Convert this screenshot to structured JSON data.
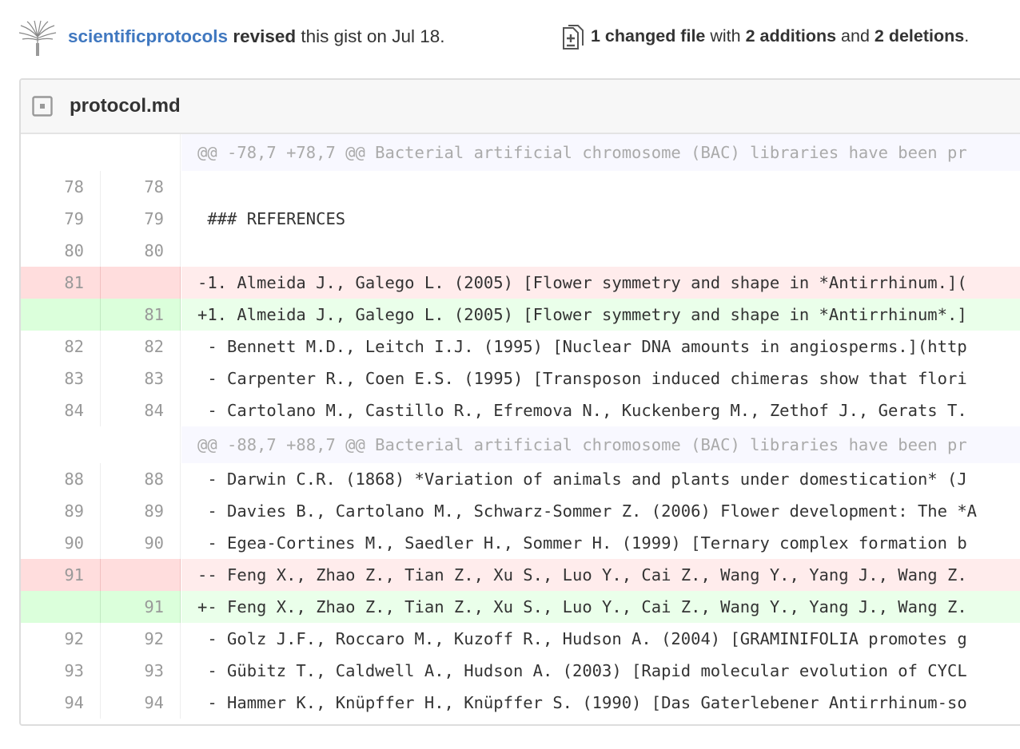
{
  "header": {
    "username": "scientificprotocols",
    "action": "revised",
    "rest": "this gist on Jul 18.",
    "summary": {
      "changed": "1 changed file",
      "with": "with",
      "additions": "2 additions",
      "and": "and",
      "deletions": "2 deletions",
      "period": "."
    }
  },
  "file": {
    "name": "protocol.md"
  },
  "diff": [
    {
      "type": "hunk",
      "old": "",
      "new": "",
      "text": "@@ -78,7 +78,7 @@ Bacterial artificial chromosome (BAC) libraries have been pr"
    },
    {
      "type": "ctx",
      "old": "78",
      "new": "78",
      "text": " "
    },
    {
      "type": "ctx",
      "old": "79",
      "new": "79",
      "text": " ### REFERENCES"
    },
    {
      "type": "ctx",
      "old": "80",
      "new": "80",
      "text": " "
    },
    {
      "type": "del",
      "old": "81",
      "new": "",
      "text": "-1. Almeida J., Galego L. (2005) [Flower symmetry and shape in *Antirrhinum.]("
    },
    {
      "type": "add",
      "old": "",
      "new": "81",
      "text": "+1. Almeida J., Galego L. (2005) [Flower symmetry and shape in *Antirrhinum*.]"
    },
    {
      "type": "ctx",
      "old": "82",
      "new": "82",
      "text": " - Bennett M.D., Leitch I.J. (1995) [Nuclear DNA amounts in angiosperms.](http"
    },
    {
      "type": "ctx",
      "old": "83",
      "new": "83",
      "text": " - Carpenter R., Coen E.S. (1995) [Transposon induced chimeras show that flori"
    },
    {
      "type": "ctx",
      "old": "84",
      "new": "84",
      "text": " - Cartolano M., Castillo R., Efremova N., Kuckenberg M., Zethof J., Gerats T."
    },
    {
      "type": "hunk",
      "old": "",
      "new": "",
      "text": "@@ -88,7 +88,7 @@ Bacterial artificial chromosome (BAC) libraries have been pr"
    },
    {
      "type": "ctx",
      "old": "88",
      "new": "88",
      "text": " - Darwin C.R. (1868) *Variation of animals and plants under domestication* (J"
    },
    {
      "type": "ctx",
      "old": "89",
      "new": "89",
      "text": " - Davies B., Cartolano M., Schwarz-Sommer Z. (2006) Flower development: The *A"
    },
    {
      "type": "ctx",
      "old": "90",
      "new": "90",
      "text": " - Egea-Cortines M., Saedler H., Sommer H. (1999) [Ternary complex formation b"
    },
    {
      "type": "del",
      "old": "91",
      "new": "",
      "text": "-- Feng X., Zhao Z., Tian Z., Xu S., Luo Y., Cai Z., Wang Y., Yang J., Wang Z."
    },
    {
      "type": "add",
      "old": "",
      "new": "91",
      "text": "+- Feng X., Zhao Z., Tian Z., Xu S., Luo Y., Cai Z., Wang Y., Yang J., Wang Z."
    },
    {
      "type": "ctx",
      "old": "92",
      "new": "92",
      "text": " - Golz J.F., Roccaro M., Kuzoff R., Hudson A. (2004) [GRAMINIFOLIA promotes g"
    },
    {
      "type": "ctx",
      "old": "93",
      "new": "93",
      "text": " - Gübitz T., Caldwell A., Hudson A. (2003) [Rapid molecular evolution of CYCL"
    },
    {
      "type": "ctx",
      "old": "94",
      "new": "94",
      "text": " - Hammer K., Knüpffer H., Knüpffer S. (1990) [Das Gaterlebener Antirrhinum-so"
    }
  ]
}
